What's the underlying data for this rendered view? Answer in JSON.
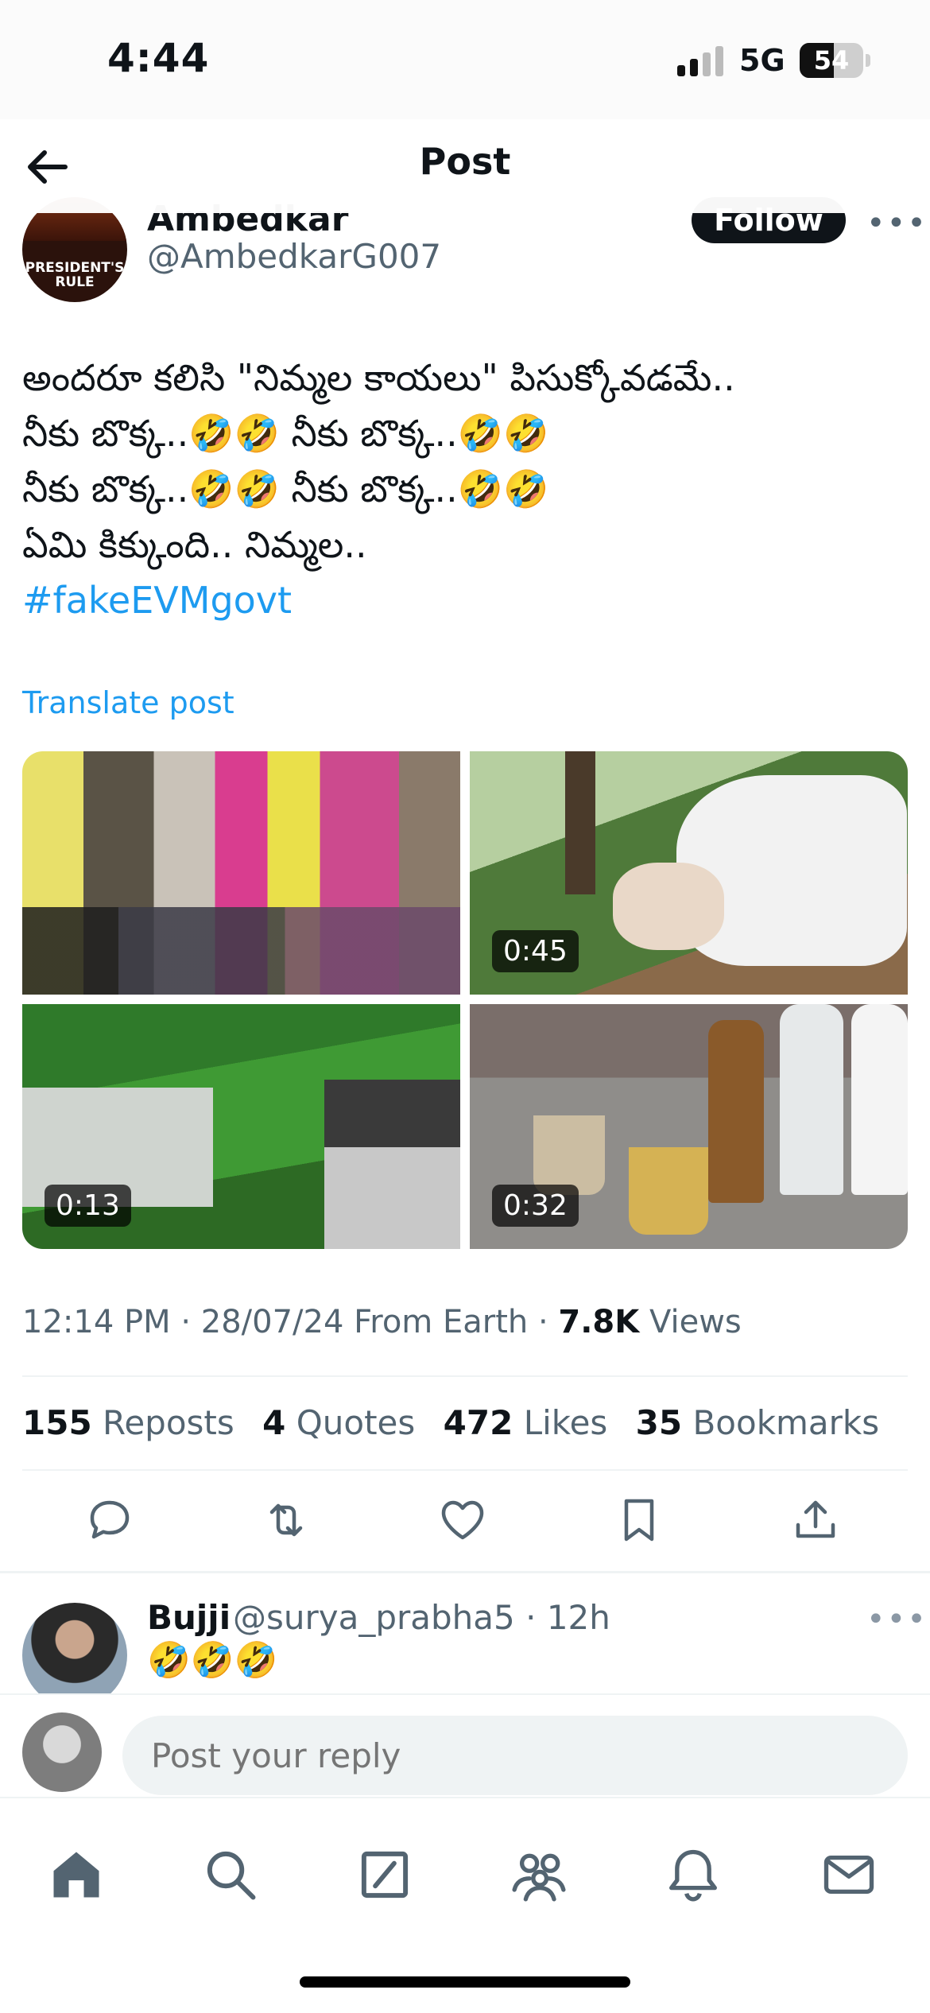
{
  "status_bar": {
    "time": "4:44",
    "network": "5G",
    "battery": "54",
    "battery_level": 0.54
  },
  "header": {
    "title": "Post"
  },
  "author": {
    "name": "Ambedkar",
    "handle": "@AmbedkarG007",
    "avatar_text": "PRESIDENT'S RULE",
    "follow_label": "Follow"
  },
  "post": {
    "lines": [
      "అందరూ కలిసి \"నిమ్మల కాయలు\" పిసుక్కోవడమే..",
      "నీకు బొక్క..🤣🤣  నీకు బొక్క..🤣🤣",
      "నీకు బొక్క..🤣🤣  నీకు బొక్క..🤣🤣",
      "ఏమి కిక్కుంది.. నిమ్మల.."
    ],
    "hashtag": "#fakeEVMgovt",
    "translate_label": "Translate post"
  },
  "media": [
    {
      "name": "crowd-video",
      "duration": ""
    },
    {
      "name": "cow-calf-video",
      "duration": "0:45"
    },
    {
      "name": "graves-video",
      "duration": "0:13"
    },
    {
      "name": "drinks-video",
      "duration": "0:32"
    }
  ],
  "meta": {
    "time": "12:14 PM",
    "date": "28/07/24",
    "source": "From Earth",
    "views_count": "7.8K",
    "views_label": "Views"
  },
  "stats": [
    {
      "count": "155",
      "label": "Reposts"
    },
    {
      "count": "4",
      "label": "Quotes"
    },
    {
      "count": "472",
      "label": "Likes"
    },
    {
      "count": "35",
      "label": "Bookmarks"
    }
  ],
  "actions": [
    "reply-icon",
    "repost-icon",
    "like-icon",
    "bookmark-icon",
    "share-icon"
  ],
  "reply": {
    "name": "Bujji",
    "handle": "@surya_prabha5",
    "time": "12h",
    "text": "🤣🤣🤣"
  },
  "composer": {
    "placeholder": "Post your reply"
  },
  "tabbar": [
    "home-icon",
    "search-icon",
    "grok-icon",
    "communities-icon",
    "notifications-icon",
    "messages-icon"
  ],
  "colors": {
    "accent": "#1d9bf0",
    "text": "#0f1419",
    "secondary": "#536471",
    "border": "#eff3f4"
  }
}
